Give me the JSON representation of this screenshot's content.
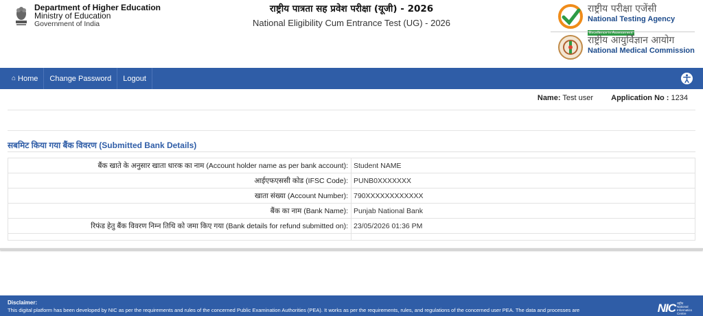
{
  "header": {
    "dept_line1": "Department of Higher Education",
    "dept_line2": "Ministry of Education",
    "dept_line3": "Government of India",
    "title_hindi": "राष्ट्रीय पात्रता सह प्रवेश परीक्षा (यूजी) - 2026",
    "title_english": "National Eligibility Cum Entrance Test (UG) - 2026",
    "nta_hindi": "राष्ट्रीय परीक्षा एजेंसी",
    "nta_english": "National Testing Agency",
    "nta_tagline": "Excellence in Assessment",
    "nmc_hindi": "राष्ट्रीय आयुर्विज्ञान आयोग",
    "nmc_english": "National Medical Commission"
  },
  "nav": {
    "home": "Home",
    "change_password": "Change Password",
    "logout": "Logout"
  },
  "user": {
    "name_label": "Name:",
    "name_value": "Test user",
    "app_label": "Application No :",
    "app_value": "1234"
  },
  "section_title": "सबमिट किया गया बैंक विवरण (Submitted Bank Details)",
  "bank_rows": [
    {
      "label": "बैंक खाते के अनुसार खाता धारक का नाम (Account holder name as per bank account):",
      "value": "Student NAME"
    },
    {
      "label": "आईएफएससी कोड (IFSC Code):",
      "value": "PUNB0XXXXXXX"
    },
    {
      "label": "खाता संख्या (Account Number):",
      "value": "790XXXXXXXXXXXX"
    },
    {
      "label": "बैंक का नाम (Bank Name):",
      "value": "Punjab National Bank"
    },
    {
      "label": "रिफंड हेतु बैंक विवरण निम्न तिथि को जमा किए गया (Bank details for refund submitted on):",
      "value": "23/05/2026 01:36 PM"
    }
  ],
  "footer": {
    "disclaimer_title": "Disclaimer:",
    "disclaimer_text": "This digital platform has been developed by NIC as per the requirements and rules of the concerned Public Examination Authorities (PEA). It works as per the requirements, rules, and regulations of the concerned user PEA. The data and processes are",
    "nic_logo": "NIC",
    "nic_hindi": "राष्ट्रीय",
    "nic_line2": "National",
    "nic_line3": "Informatics",
    "nic_line4": "Centre"
  },
  "colors": {
    "primary": "#2f5da7",
    "title_blue": "#2f5da7"
  }
}
